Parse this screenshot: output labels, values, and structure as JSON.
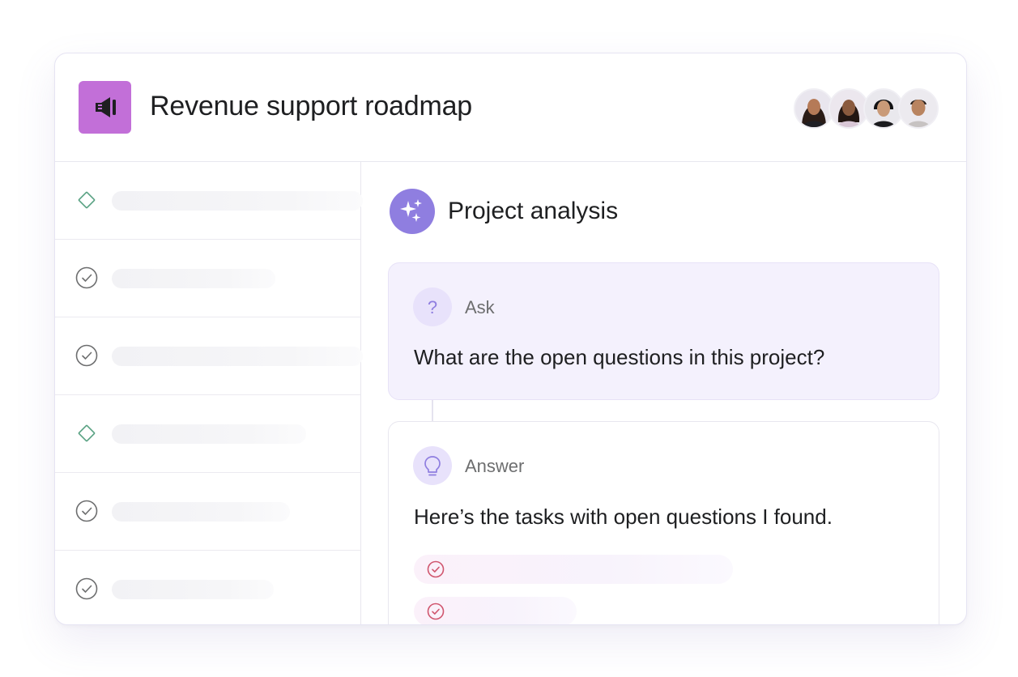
{
  "header": {
    "title": "Revenue support roadmap",
    "project_icon": "megaphone-icon",
    "project_color": "#c26fd8",
    "members": [
      "member-avatar-1",
      "member-avatar-2",
      "member-avatar-3",
      "member-avatar-4"
    ]
  },
  "sidebar": {
    "rows": [
      {
        "icon": "milestone-diamond-icon"
      },
      {
        "icon": "check-circle-icon"
      },
      {
        "icon": "check-circle-icon"
      },
      {
        "icon": "milestone-diamond-icon"
      },
      {
        "icon": "check-circle-icon"
      },
      {
        "icon": "check-circle-icon"
      }
    ]
  },
  "analysis": {
    "title": "Project analysis",
    "icon": "sparkles-icon",
    "accent": "#8f7ee0",
    "ask": {
      "label": "Ask",
      "icon": "question-mark-icon",
      "text": "What are the open questions in this project?"
    },
    "answer": {
      "label": "Answer",
      "icon": "lightbulb-icon",
      "text": "Here’s the tasks with open questions I found.",
      "result_icon": "check-circle-icon",
      "result_color": "#d0566e"
    }
  }
}
